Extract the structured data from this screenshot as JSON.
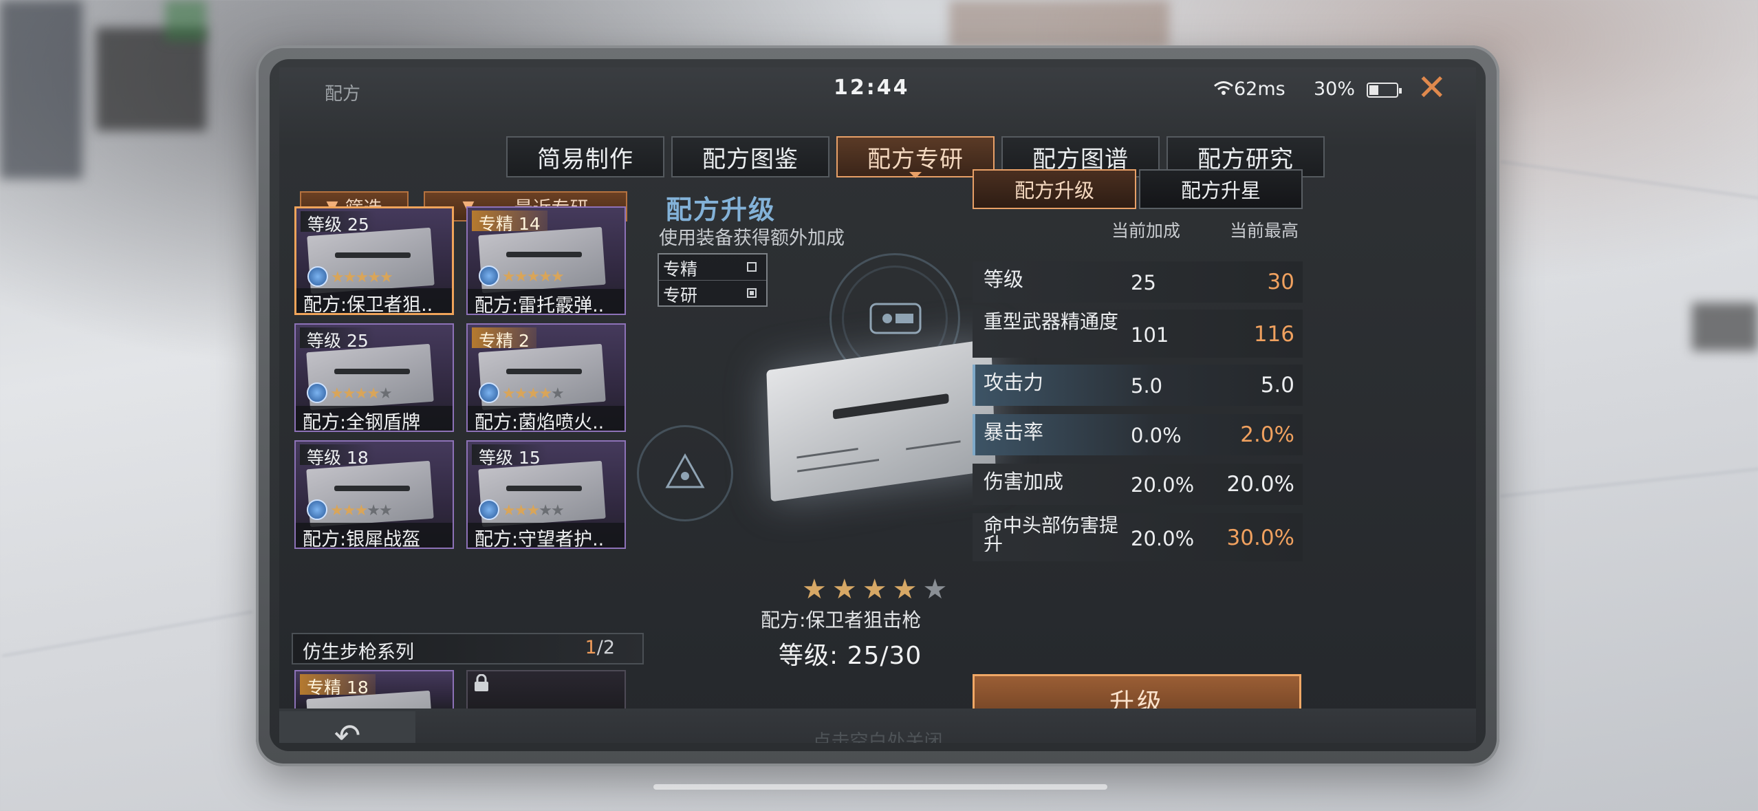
{
  "topbar": {
    "title": "配方",
    "clock": "12:44",
    "ping": "62ms",
    "battery": "30%"
  },
  "tabs": [
    {
      "label": "简易制作"
    },
    {
      "label": "配方图鉴"
    },
    {
      "label": "配方专研"
    },
    {
      "label": "配方图谱"
    },
    {
      "label": "配方研究"
    }
  ],
  "active_tab": "配方专研",
  "left": {
    "filter_label": "筛选",
    "recent_label": "最近专研",
    "cards": [
      {
        "badge": "等级 25",
        "name": "配方:保卫者狙..",
        "stars": 5,
        "lit": 5
      },
      {
        "badge": "专精 14",
        "name": "配方:雷托霰弹..",
        "stars": 5,
        "lit": 5
      },
      {
        "badge": "等级 25",
        "name": "配方:全钢盾牌",
        "stars": 5,
        "lit": 4
      },
      {
        "badge": "专精 2",
        "name": "配方:菌焰喷火..",
        "stars": 5,
        "lit": 4
      },
      {
        "badge": "等级 18",
        "name": "配方:银犀战盔",
        "stars": 5,
        "lit": 3
      },
      {
        "badge": "等级 15",
        "name": "配方:守望者护..",
        "stars": 5,
        "lit": 3
      }
    ],
    "series": {
      "title": "仿生步枪系列",
      "page_current": "1",
      "page_total": "/2"
    },
    "series_card_badge": "专精 18"
  },
  "center": {
    "title": "配方升级",
    "subtitle": "使用装备获得额外加成",
    "checks": [
      {
        "label": "专精",
        "checked": false
      },
      {
        "label": "专研",
        "checked": true
      }
    ],
    "stars_total": 5,
    "stars_lit": 4,
    "weapon_name": "配方:保卫者狙击枪",
    "level_text": "等级: 25/30"
  },
  "right": {
    "tabs": [
      {
        "label": "配方升级"
      },
      {
        "label": "配方升星"
      }
    ],
    "col_current": "当前加成",
    "col_max": "当前最高",
    "rows": [
      {
        "label": "等级",
        "current": "25",
        "max": "30",
        "style": "plain",
        "up": true
      },
      {
        "label": "重型武器精通度",
        "current": "101",
        "max": "116",
        "style": "plain",
        "up": true
      },
      {
        "label": "攻击力",
        "current": "5.0",
        "max": "5.0",
        "style": "blue",
        "up": false
      },
      {
        "label": "暴击率",
        "current": "0.0%",
        "max": "2.0%",
        "style": "blue",
        "up": true
      },
      {
        "label": "伤害加成",
        "current": "20.0%",
        "max": "20.0%",
        "style": "plain",
        "up": false
      },
      {
        "label": "命中头部伤害提升",
        "current": "20.0%",
        "max": "30.0%",
        "style": "plain",
        "up": true
      }
    ],
    "upgrade_label": "升级"
  },
  "bottom": {
    "hint": "点击空白处关闭"
  },
  "colors": {
    "accent": "#e8a067",
    "title_blue": "#83b2d8",
    "increase": "#f0a15f",
    "card_border": "#8d72b8"
  },
  "icons": [
    "wifi-icon",
    "battery-icon",
    "close-icon",
    "filter-triangle-icon",
    "back-arrow-icon",
    "lock-icon",
    "star-icon"
  ]
}
